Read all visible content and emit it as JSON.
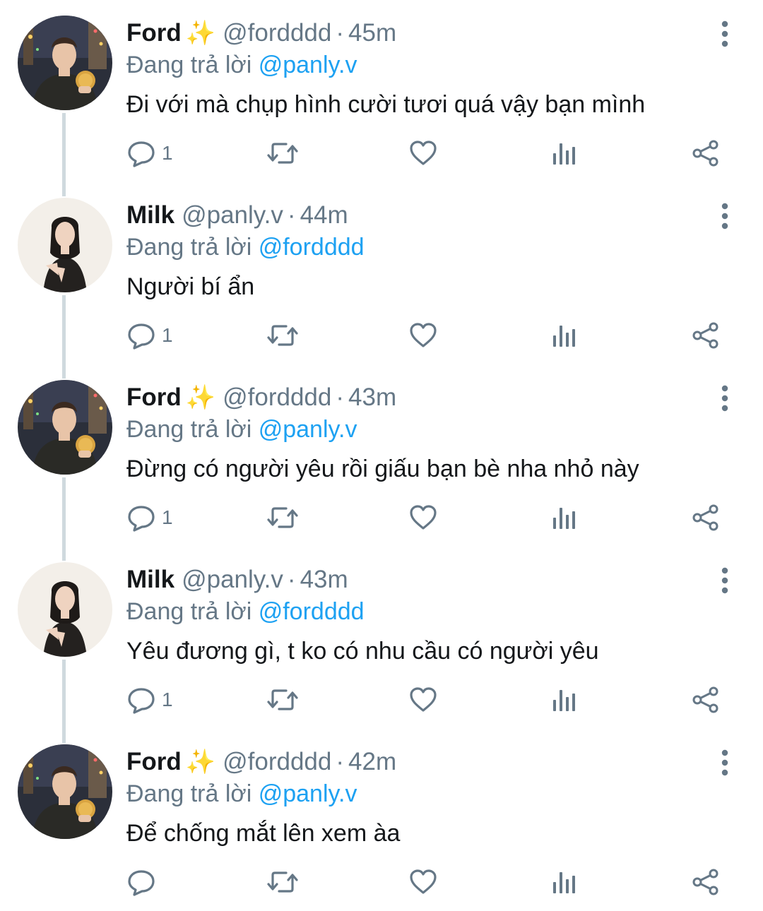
{
  "tweets": [
    {
      "author": "Ford",
      "emoji": "✨",
      "handle": "@fordddd",
      "time": "45m",
      "replying_prefix": "Đang trả lời",
      "replying_to": "@panly.v",
      "text": "Đi với mà chụp hình cười tươi quá vậy bạn mình",
      "reply_count": "1",
      "avatar": "ford"
    },
    {
      "author": "Milk",
      "emoji": "",
      "handle": "@panly.v",
      "time": "44m",
      "replying_prefix": "Đang trả lời",
      "replying_to": "@fordddd",
      "text": "Người bí ẩn",
      "reply_count": "1",
      "avatar": "milk"
    },
    {
      "author": "Ford",
      "emoji": "✨",
      "handle": "@fordddd",
      "time": "43m",
      "replying_prefix": "Đang trả lời",
      "replying_to": "@panly.v",
      "text": "Đừng có người yêu rồi giấu bạn bè nha nhỏ này",
      "reply_count": "1",
      "avatar": "ford"
    },
    {
      "author": "Milk",
      "emoji": "",
      "handle": "@panly.v",
      "time": "43m",
      "replying_prefix": "Đang trả lời",
      "replying_to": "@fordddd",
      "text": "Yêu đương gì, t ko có nhu cầu có người yêu",
      "reply_count": "1",
      "avatar": "milk"
    },
    {
      "author": "Ford",
      "emoji": "✨",
      "handle": "@fordddd",
      "time": "42m",
      "replying_prefix": "Đang trả lời",
      "replying_to": "@panly.v",
      "text": "Để chống mắt lên xem àa",
      "reply_count": "",
      "avatar": "ford"
    }
  ],
  "icons": {
    "reply": "reply-icon",
    "retweet": "retweet-icon",
    "like": "like-icon",
    "views": "analytics-icon",
    "share": "share-icon",
    "more": "more-icon"
  },
  "colors": {
    "text": "#14171a",
    "muted": "#657786",
    "link": "#1da1f2",
    "thread_line": "#cfd9de"
  }
}
